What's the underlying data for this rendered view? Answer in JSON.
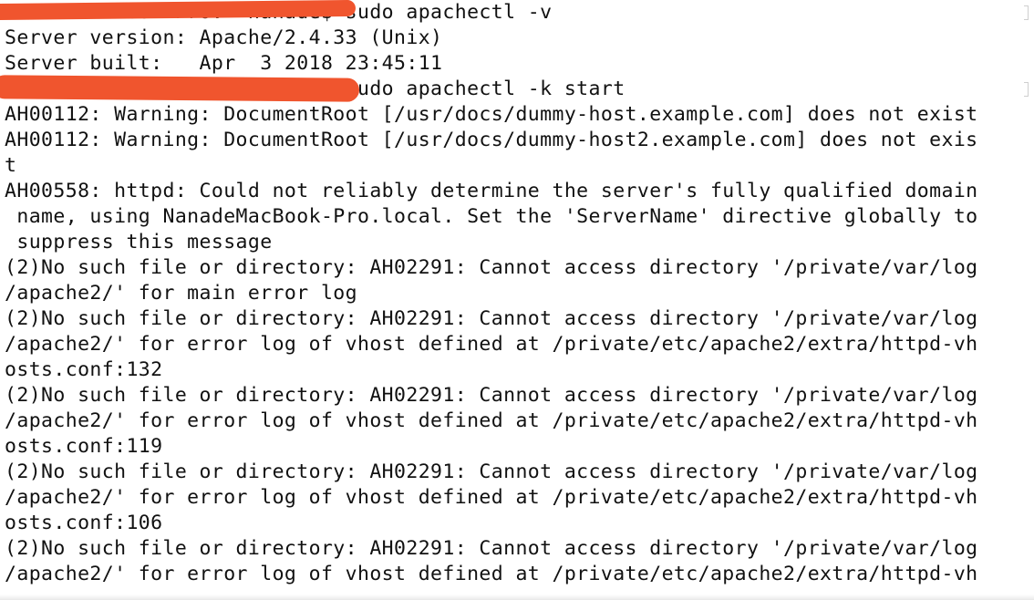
{
  "terminal": {
    "lines": [
      "NanadeMacBook-Pro:~ nanade$ sudo apachectl -v",
      "Server version: Apache/2.4.33 (Unix)",
      "Server built:   Apr  3 2018 23:45:11",
      "NanadeMacBook-Pro:~ nanade$ sudo apachectl -k start",
      "AH00112: Warning: DocumentRoot [/usr/docs/dummy-host.example.com] does not exist",
      "AH00112: Warning: DocumentRoot [/usr/docs/dummy-host2.example.com] does not exis",
      "t",
      "AH00558: httpd: Could not reliably determine the server's fully qualified domain",
      " name, using NanadeMacBook-Pro.local. Set the 'ServerName' directive globally to",
      " suppress this message",
      "(2)No such file or directory: AH02291: Cannot access directory '/private/var/log",
      "/apache2/' for main error log",
      "(2)No such file or directory: AH02291: Cannot access directory '/private/var/log",
      "/apache2/' for error log of vhost defined at /private/etc/apache2/extra/httpd-vh",
      "osts.conf:132",
      "(2)No such file or directory: AH02291: Cannot access directory '/private/var/log",
      "/apache2/' for error log of vhost defined at /private/etc/apache2/extra/httpd-vh",
      "osts.conf:119",
      "(2)No such file or directory: AH02291: Cannot access directory '/private/var/log",
      "/apache2/' for error log of vhost defined at /private/etc/apache2/extra/httpd-vh",
      "osts.conf:106",
      "(2)No such file or directory: AH02291: Cannot access directory '/private/var/log",
      "/apache2/' for error log of vhost defined at /private/etc/apache2/extra/httpd-vh"
    ]
  },
  "colors": {
    "background": "#ffffff",
    "text": "#111111",
    "redaction": "#f0552e"
  }
}
